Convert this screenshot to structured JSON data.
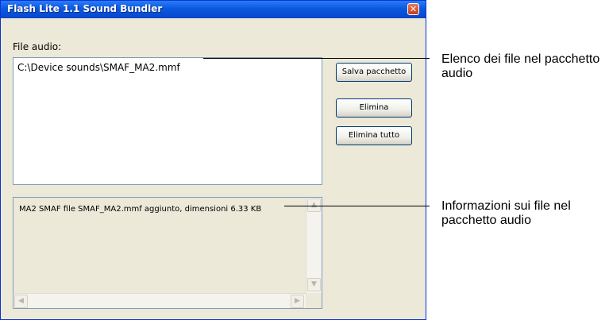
{
  "window": {
    "title": "Flash Lite 1.1 Sound Bundler",
    "close_glyph": "✕"
  },
  "file_list": {
    "label": "File audio:",
    "items": [
      "C:\\Device sounds\\SMAF_MA2.mmf"
    ]
  },
  "buttons": {
    "save": "Salva pacchetto",
    "remove": "Elimina",
    "remove_all": "Elimina tutto"
  },
  "info": {
    "text": "MA2 SMAF file SMAF_MA2.mmf aggiunto, dimensioni 6.33 KB"
  },
  "scrollbar_glyphs": {
    "up": "▲",
    "down": "▼",
    "left": "◀",
    "right": "▶"
  },
  "callouts": {
    "file_list": "Elenco dei file nel pacchetto audio",
    "info": "Informazioni sui file nel pacchetto audio"
  },
  "colors": {
    "titlebar": "#0a58e0",
    "dialog_bg": "#ece9d8",
    "close_button": "#c63c1a"
  }
}
